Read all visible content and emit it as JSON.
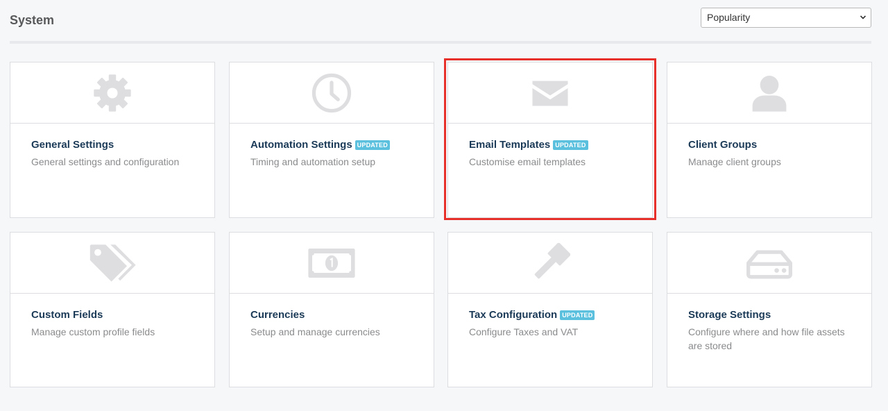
{
  "page": {
    "title": "System"
  },
  "sort": {
    "selected": "Popularity"
  },
  "cards": [
    {
      "title": "General Settings",
      "description": "General settings and configuration",
      "badge": "",
      "icon": "gear-icon"
    },
    {
      "title": "Automation Settings",
      "description": "Timing and automation setup",
      "badge": "UPDATED",
      "icon": "clock-icon"
    },
    {
      "title": "Email Templates",
      "description": "Customise email templates",
      "badge": "UPDATED",
      "icon": "envelope-icon"
    },
    {
      "title": "Client Groups",
      "description": "Manage client groups",
      "badge": "",
      "icon": "user-icon"
    },
    {
      "title": "Custom Fields",
      "description": "Manage custom profile fields",
      "badge": "",
      "icon": "tags-icon"
    },
    {
      "title": "Currencies",
      "description": "Setup and manage currencies",
      "badge": "",
      "icon": "money-bill-icon"
    },
    {
      "title": "Tax Configuration",
      "description": "Configure Taxes and VAT",
      "badge": "UPDATED",
      "icon": "gavel-icon"
    },
    {
      "title": "Storage Settings",
      "description": "Configure where and how file assets are stored",
      "badge": "",
      "icon": "hard-drive-icon"
    }
  ],
  "colors": {
    "badge": "#5bc0de",
    "highlight": "#e8302b",
    "title": "#1b3a57"
  }
}
